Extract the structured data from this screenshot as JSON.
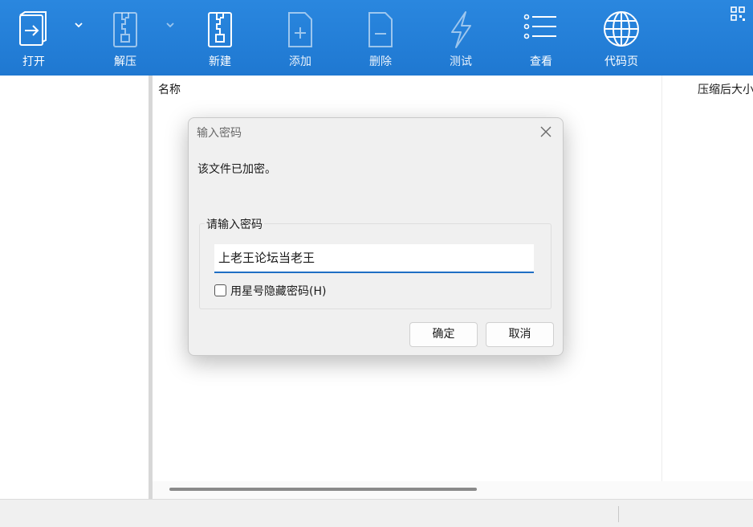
{
  "toolbar": {
    "items": [
      {
        "label": "打开",
        "icon": "open-file-icon"
      },
      {
        "label": "解压",
        "icon": "extract-zip-icon"
      },
      {
        "label": "新建",
        "icon": "new-archive-icon"
      },
      {
        "label": "添加",
        "icon": "add-file-icon"
      },
      {
        "label": "删除",
        "icon": "delete-file-icon"
      },
      {
        "label": "测试",
        "icon": "test-lightning-icon"
      },
      {
        "label": "查看",
        "icon": "view-list-icon"
      },
      {
        "label": "代码页",
        "icon": "globe-icon"
      }
    ]
  },
  "list": {
    "columns": [
      "名称",
      "压缩后大小"
    ]
  },
  "dialog": {
    "title": "输入密码",
    "message": "该文件已加密。",
    "group_label": "请输入密码",
    "password_value": "上老王论坛当老王",
    "checkbox_label": "用星号隐藏密码(H)",
    "checkbox_checked": false,
    "ok_label": "确定",
    "cancel_label": "取消"
  },
  "colors": {
    "toolbar_bg": "#1f78d1",
    "accent": "#1f6fc4"
  }
}
